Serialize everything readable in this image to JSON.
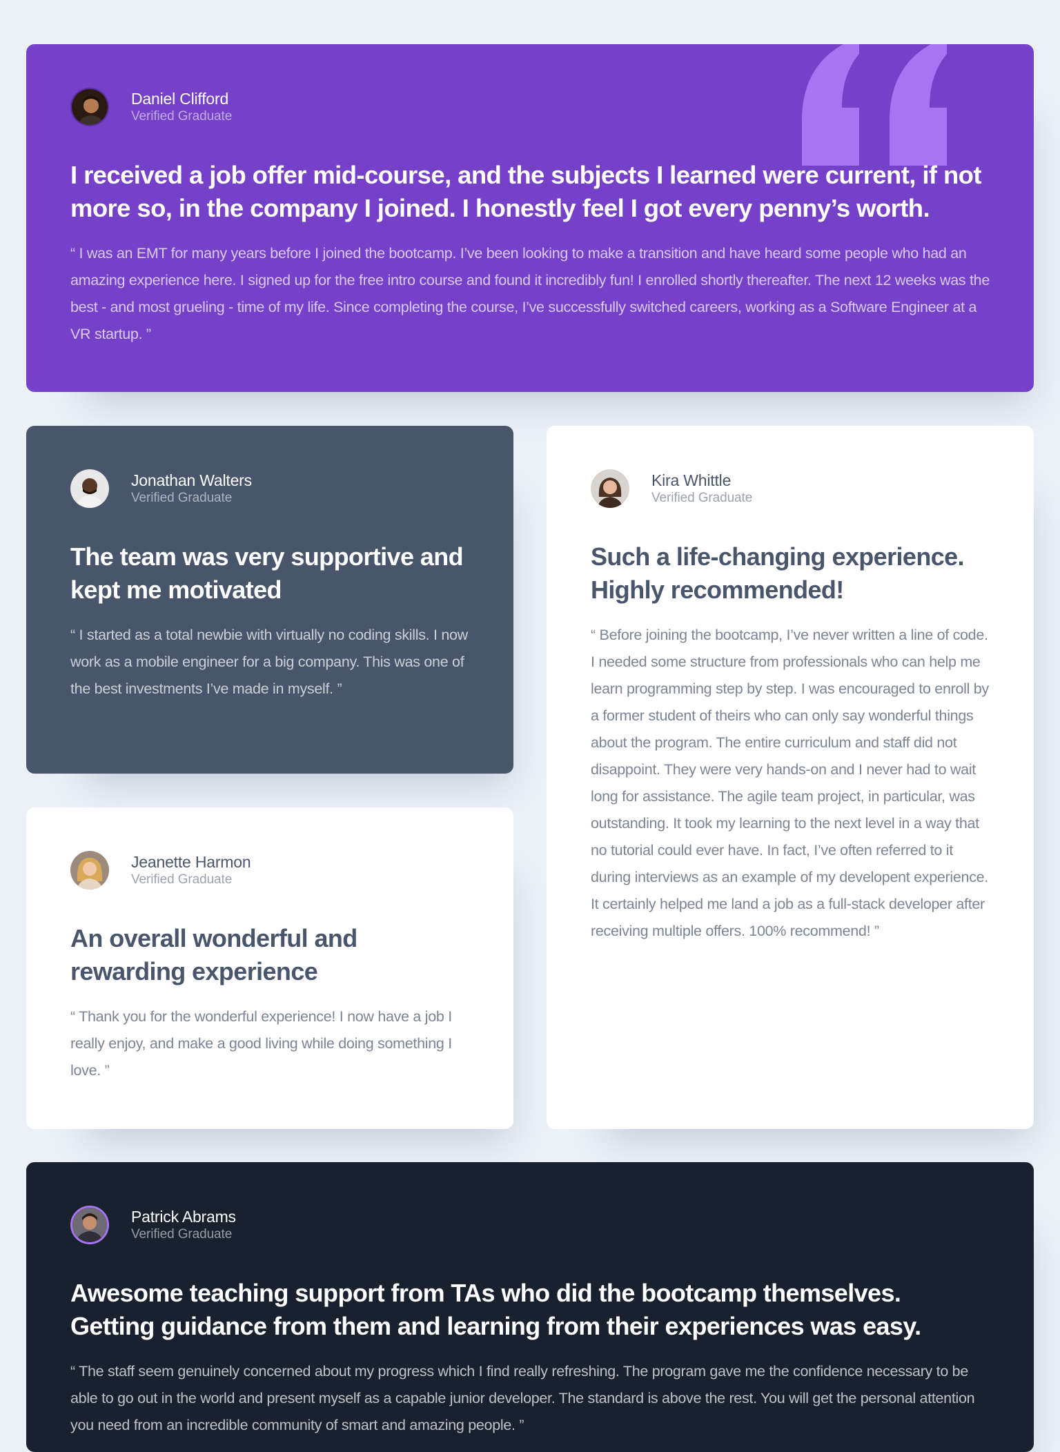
{
  "colors": {
    "background": "#ECF1F8",
    "moderate_violet": "#7541C8",
    "grayish_blue": "#48556A",
    "white": "#FFFFFF",
    "very_dark_blackish_blue": "#19212E",
    "light_violet": "#A775F1"
  },
  "testimonials": [
    {
      "name": "Daniel Clifford",
      "role": "Verified Graduate",
      "headline": "I received a job offer mid-course, and the subjects I learned were current, if not more so, in the company I joined. I honestly feel I got every penny’s worth.",
      "body": "“ I was an EMT for many years before I joined the bootcamp. I’ve been looking to make a transition and have heard some people who had an amazing experience here. I signed up for the free intro course and found it incredibly fun! I enrolled shortly thereafter. The next 12 weeks was the best - and most grueling - time of my life. Since completing the course, I’ve successfully switched careers, working as a Software Engineer at a VR startup. ”",
      "icon": "quotation-mark-icon"
    },
    {
      "name": "Jonathan Walters",
      "role": "Verified Graduate",
      "headline": "The team was very supportive and kept me motivated",
      "body": "“ I started as a total newbie with virtually no coding skills. I now work as a mobile engineer for a big company. This was one of the best investments I’ve made in myself. ”"
    },
    {
      "name": "Kira Whittle",
      "role": "Verified Graduate",
      "headline": "Such a life-changing experience. Highly recommended!",
      "body": "“ Before joining the bootcamp, I’ve never written a line of code. I needed some structure from professionals who can help me learn programming step by step. I was encouraged to enroll by a former student of theirs who can only say wonderful things about the program. The entire curriculum and staff did not disappoint. They were very hands-on and I never had to wait long for assistance. The agile team project, in particular, was outstanding. It took my learning to the next level in a way that no tutorial could ever have. In fact, I’ve often referred to it during interviews as an example of my developent experience. It certainly helped me land a job as a full-stack developer after receiving multiple offers. 100% recommend! ”"
    },
    {
      "name": "Jeanette Harmon",
      "role": "Verified Graduate",
      "headline": "An overall wonderful and rewarding experience",
      "body": "“ Thank you for the wonderful experience! I now have a job I really enjoy, and make a good living while doing something I love. ”"
    },
    {
      "name": "Patrick Abrams",
      "role": "Verified Graduate",
      "headline": "Awesome teaching support from TAs who did the bootcamp themselves. Getting guidance from them and learning from their experiences was easy.",
      "body": "“ The staff seem genuinely concerned about my progress which I find really refreshing. The program gave me the confidence necessary to be able to go out in the world and present myself as a capable junior developer. The standard is above the rest. You will get the personal attention you need from an incredible community of smart and amazing people. ”"
    }
  ]
}
